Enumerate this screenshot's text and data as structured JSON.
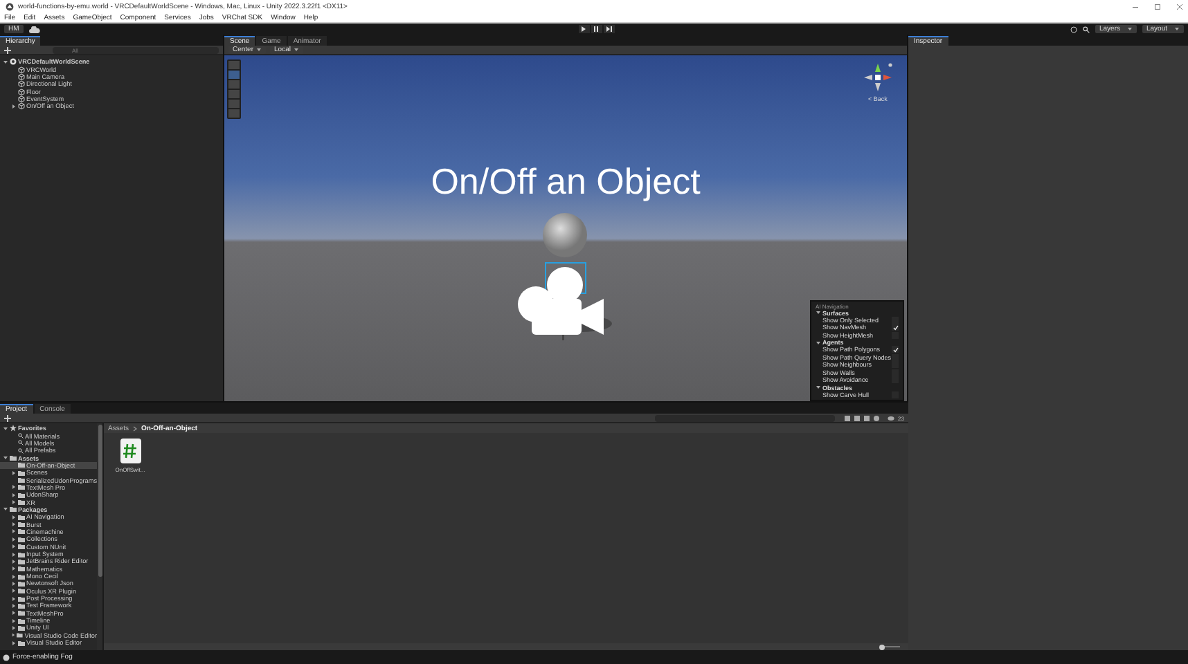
{
  "window": {
    "title": "world-functions-by-emu.world - VRCDefaultWorldScene - Windows, Mac, Linux - Unity 2022.3.22f1 <DX11>"
  },
  "menu": [
    "File",
    "Edit",
    "Assets",
    "GameObject",
    "Component",
    "Services",
    "Jobs",
    "VRChat SDK",
    "Window",
    "Help"
  ],
  "toolbar": {
    "account": "HM",
    "layers": "Layers",
    "layout": "Layout"
  },
  "hierarchy": {
    "tab": "Hierarchy",
    "search_placeholder": "All",
    "items": [
      {
        "label": "VRCDefaultWorldScene",
        "kind": "scene",
        "expanded": true,
        "selected": false,
        "children": [
          {
            "label": "VRCWorld",
            "kind": "object",
            "selected": false
          },
          {
            "label": "Main Camera",
            "kind": "object",
            "selected": false
          },
          {
            "label": "Directional Light",
            "kind": "object",
            "selected": false
          },
          {
            "label": "Floor",
            "kind": "object",
            "selected": false
          },
          {
            "label": "EventSystem",
            "kind": "object",
            "selected": false
          },
          {
            "label": "On/Off an Object",
            "kind": "object",
            "expanded": false,
            "selected": false
          }
        ]
      }
    ]
  },
  "scene": {
    "tabs": [
      {
        "label": "Scene",
        "selected": true
      },
      {
        "label": "Game",
        "selected": false
      },
      {
        "label": "Animator",
        "selected": false
      }
    ],
    "pivot": "Center",
    "space": "Local",
    "object_text": "On/Off an Object",
    "back_label": "< Back",
    "tools": [
      {
        "selected": false
      },
      {
        "selected": true
      },
      {
        "selected": false
      },
      {
        "selected": false
      },
      {
        "selected": false
      },
      {
        "selected": false
      }
    ],
    "nav_overlay": {
      "title": "AI Navigation",
      "sections": [
        {
          "label": "Surfaces",
          "expanded": true,
          "options": [
            {
              "label": "Show Only Selected",
              "checked": false
            },
            {
              "label": "Show NavMesh",
              "checked": true
            },
            {
              "label": "Show HeightMesh",
              "checked": false
            }
          ]
        },
        {
          "label": "Agents",
          "expanded": true,
          "options": [
            {
              "label": "Show Path Polygons",
              "checked": true
            },
            {
              "label": "Show Path Query Nodes",
              "checked": false
            },
            {
              "label": "Show Neighbours",
              "checked": false
            },
            {
              "label": "Show Walls",
              "checked": false
            },
            {
              "label": "Show Avoidance",
              "checked": false
            }
          ]
        },
        {
          "label": "Obstacles",
          "expanded": true,
          "options": [
            {
              "label": "Show Carve Hull",
              "checked": false
            }
          ]
        }
      ]
    }
  },
  "inspector": {
    "tab": "Inspector"
  },
  "project": {
    "tabs": [
      {
        "label": "Project",
        "selected": true
      },
      {
        "label": "Console",
        "selected": false
      }
    ],
    "tree": [
      {
        "label": "Favorites",
        "kind": "star",
        "expanded": true,
        "selected": false,
        "children": [
          {
            "label": "All Materials",
            "kind": "search",
            "selected": false
          },
          {
            "label": "All Models",
            "kind": "search",
            "selected": false
          },
          {
            "label": "All Prefabs",
            "kind": "search",
            "selected": false
          }
        ]
      },
      {
        "label": "Assets",
        "kind": "folder",
        "expanded": true,
        "selected": false,
        "children": [
          {
            "label": "On-Off-an-Object",
            "kind": "folder",
            "selected": true
          },
          {
            "label": "Scenes",
            "kind": "folder",
            "expanded": false,
            "selected": false
          },
          {
            "label": "SerializedUdonPrograms",
            "kind": "folder",
            "selected": false
          },
          {
            "label": "TextMesh Pro",
            "kind": "folder",
            "expanded": false,
            "selected": false
          },
          {
            "label": "UdonSharp",
            "kind": "folder",
            "expanded": false,
            "selected": false
          },
          {
            "label": "XR",
            "kind": "folder",
            "expanded": false,
            "selected": false
          }
        ]
      },
      {
        "label": "Packages",
        "kind": "folder",
        "expanded": true,
        "selected": false,
        "children": [
          {
            "label": "AI Navigation",
            "kind": "folder",
            "expanded": false,
            "selected": false
          },
          {
            "label": "Burst",
            "kind": "folder",
            "expanded": false,
            "selected": false
          },
          {
            "label": "Cinemachine",
            "kind": "folder",
            "expanded": false,
            "selected": false
          },
          {
            "label": "Collections",
            "kind": "folder",
            "expanded": false,
            "selected": false
          },
          {
            "label": "Custom NUnit",
            "kind": "folder",
            "expanded": false,
            "selected": false
          },
          {
            "label": "Input System",
            "kind": "folder",
            "expanded": false,
            "selected": false
          },
          {
            "label": "JetBrains Rider Editor",
            "kind": "folder",
            "expanded": false,
            "selected": false
          },
          {
            "label": "Mathematics",
            "kind": "folder",
            "expanded": false,
            "selected": false
          },
          {
            "label": "Mono Cecil",
            "kind": "folder",
            "expanded": false,
            "selected": false
          },
          {
            "label": "Newtonsoft Json",
            "kind": "folder",
            "expanded": false,
            "selected": false
          },
          {
            "label": "Oculus XR Plugin",
            "kind": "folder",
            "expanded": false,
            "selected": false
          },
          {
            "label": "Post Processing",
            "kind": "folder",
            "expanded": false,
            "selected": false
          },
          {
            "label": "Test Framework",
            "kind": "folder",
            "expanded": false,
            "selected": false
          },
          {
            "label": "TextMeshPro",
            "kind": "folder",
            "expanded": false,
            "selected": false
          },
          {
            "label": "Timeline",
            "kind": "folder",
            "expanded": false,
            "selected": false
          },
          {
            "label": "Unity UI",
            "kind": "folder",
            "expanded": false,
            "selected": false
          },
          {
            "label": "Visual Studio Code Editor",
            "kind": "folder",
            "expanded": false,
            "selected": false
          },
          {
            "label": "Visual Studio Editor",
            "kind": "folder",
            "expanded": false,
            "selected": false
          }
        ]
      }
    ],
    "breadcrumb": [
      "Assets",
      "On-Off-an-Object"
    ],
    "assets": [
      {
        "label": "OnOffSwit...",
        "kind": "script",
        "selected": false
      }
    ],
    "hidden_count": "23",
    "zoom_slider": {
      "level": 0.1
    }
  },
  "status_bar": {
    "message": "Force-enabling Fog"
  }
}
